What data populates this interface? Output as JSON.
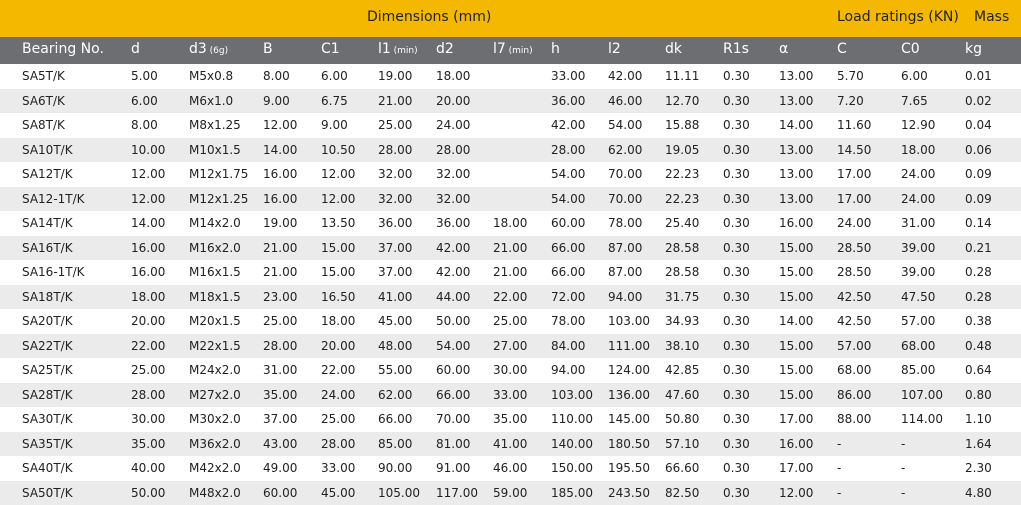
{
  "top_header": {
    "dimensions": "Dimensions (mm)",
    "load_ratings": "Load ratings (KN)",
    "mass": "Mass"
  },
  "columns": [
    {
      "label": "Bearing No.",
      "sub": ""
    },
    {
      "label": "d",
      "sub": ""
    },
    {
      "label": "d3",
      "sub": "(6g)"
    },
    {
      "label": "B",
      "sub": ""
    },
    {
      "label": "C1",
      "sub": ""
    },
    {
      "label": "l1",
      "sub": "(min)"
    },
    {
      "label": "d2",
      "sub": ""
    },
    {
      "label": "l7",
      "sub": "(min)"
    },
    {
      "label": "h",
      "sub": ""
    },
    {
      "label": "l2",
      "sub": ""
    },
    {
      "label": "dk",
      "sub": ""
    },
    {
      "label": "R1s",
      "sub": ""
    },
    {
      "label": "α",
      "sub": ""
    },
    {
      "label": "C",
      "sub": ""
    },
    {
      "label": "C0",
      "sub": ""
    },
    {
      "label": "kg",
      "sub": ""
    }
  ],
  "rows": [
    [
      "SA5T/K",
      "5.00",
      "M5x0.8",
      "8.00",
      "6.00",
      "19.00",
      "18.00",
      "",
      "33.00",
      "42.00",
      "11.11",
      "0.30",
      "13.00",
      "5.70",
      "6.00",
      "0.01"
    ],
    [
      "SA6T/K",
      "6.00",
      "M6x1.0",
      "9.00",
      "6.75",
      "21.00",
      "20.00",
      "",
      "36.00",
      "46.00",
      "12.70",
      "0.30",
      "13.00",
      "7.20",
      "7.65",
      "0.02"
    ],
    [
      "SA8T/K",
      "8.00",
      "M8x1.25",
      "12.00",
      "9.00",
      "25.00",
      "24.00",
      "",
      "42.00",
      "54.00",
      "15.88",
      "0.30",
      "14.00",
      "11.60",
      "12.90",
      "0.04"
    ],
    [
      "SA10T/K",
      "10.00",
      "M10x1.5",
      "14.00",
      "10.50",
      "28.00",
      "28.00",
      "",
      "28.00",
      "62.00",
      "19.05",
      "0.30",
      "13.00",
      "14.50",
      "18.00",
      "0.06"
    ],
    [
      "SA12T/K",
      "12.00",
      "M12x1.75",
      "16.00",
      "12.00",
      "32.00",
      "32.00",
      "",
      "54.00",
      "70.00",
      "22.23",
      "0.30",
      "13.00",
      "17.00",
      "24.00",
      "0.09"
    ],
    [
      "SA12-1T/K",
      "12.00",
      "M12x1.25",
      "16.00",
      "12.00",
      "32.00",
      "32.00",
      "",
      "54.00",
      "70.00",
      "22.23",
      "0.30",
      "13.00",
      "17.00",
      "24.00",
      "0.09"
    ],
    [
      "SA14T/K",
      "14.00",
      "M14x2.0",
      "19.00",
      "13.50",
      "36.00",
      "36.00",
      "18.00",
      "60.00",
      "78.00",
      "25.40",
      "0.30",
      "16.00",
      "24.00",
      "31.00",
      "0.14"
    ],
    [
      "SA16T/K",
      "16.00",
      "M16x2.0",
      "21.00",
      "15.00",
      "37.00",
      "42.00",
      "21.00",
      "66.00",
      "87.00",
      "28.58",
      "0.30",
      "15.00",
      "28.50",
      "39.00",
      "0.21"
    ],
    [
      "SA16-1T/K",
      "16.00",
      "M16x1.5",
      "21.00",
      "15.00",
      "37.00",
      "42.00",
      "21.00",
      "66.00",
      "87.00",
      "28.58",
      "0.30",
      "15.00",
      "28.50",
      "39.00",
      "0.28"
    ],
    [
      "SA18T/K",
      "18.00",
      "M18x1.5",
      "23.00",
      "16.50",
      "41.00",
      "44.00",
      "22.00",
      "72.00",
      "94.00",
      "31.75",
      "0.30",
      "15.00",
      "42.50",
      "47.50",
      "0.28"
    ],
    [
      "SA20T/K",
      "20.00",
      "M20x1.5",
      "25.00",
      "18.00",
      "45.00",
      "50.00",
      "25.00",
      "78.00",
      "103.00",
      "34.93",
      "0.30",
      "14.00",
      "42.50",
      "57.00",
      "0.38"
    ],
    [
      "SA22T/K",
      "22.00",
      "M22x1.5",
      "28.00",
      "20.00",
      "48.00",
      "54.00",
      "27.00",
      "84.00",
      "111.00",
      "38.10",
      "0.30",
      "15.00",
      "57.00",
      "68.00",
      "0.48"
    ],
    [
      "SA25T/K",
      "25.00",
      "M24x2.0",
      "31.00",
      "22.00",
      "55.00",
      "60.00",
      "30.00",
      "94.00",
      "124.00",
      "42.85",
      "0.30",
      "15.00",
      "68.00",
      "85.00",
      "0.64"
    ],
    [
      "SA28T/K",
      "28.00",
      "M27x2.0",
      "35.00",
      "24.00",
      "62.00",
      "66.00",
      "33.00",
      "103.00",
      "136.00",
      "47.60",
      "0.30",
      "15.00",
      "86.00",
      "107.00",
      "0.80"
    ],
    [
      "SA30T/K",
      "30.00",
      "M30x2.0",
      "37.00",
      "25.00",
      "66.00",
      "70.00",
      "35.00",
      "110.00",
      "145.00",
      "50.80",
      "0.30",
      "17.00",
      "88.00",
      "114.00",
      "1.10"
    ],
    [
      "SA35T/K",
      "35.00",
      "M36x2.0",
      "43.00",
      "28.00",
      "85.00",
      "81.00",
      "41.00",
      "140.00",
      "180.50",
      "57.10",
      "0.30",
      "16.00",
      "-",
      "-",
      "1.64"
    ],
    [
      "SA40T/K",
      "40.00",
      "M42x2.0",
      "49.00",
      "33.00",
      "90.00",
      "91.00",
      "46.00",
      "150.00",
      "195.50",
      "66.60",
      "0.30",
      "17.00",
      "-",
      "-",
      "2.30"
    ],
    [
      "SA50T/K",
      "50.00",
      "M48x2.0",
      "60.00",
      "45.00",
      "105.00",
      "117.00",
      "59.00",
      "185.00",
      "243.50",
      "82.50",
      "0.30",
      "12.00",
      "-",
      "-",
      "4.80"
    ]
  ]
}
